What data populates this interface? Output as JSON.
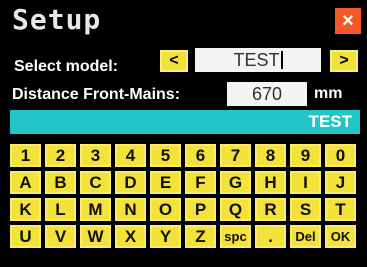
{
  "header": {
    "title": "Setup",
    "close_label": "×"
  },
  "model": {
    "label": "Select model:",
    "prev_label": "<",
    "next_label": ">",
    "value": "TEST"
  },
  "distance": {
    "label": "Distance Front-Mains:",
    "value": "670",
    "unit": "mm"
  },
  "entry": {
    "value": "TEST"
  },
  "keyboard": {
    "rows": [
      [
        "1",
        "2",
        "3",
        "4",
        "5",
        "6",
        "7",
        "8",
        "9",
        "0"
      ],
      [
        "A",
        "B",
        "C",
        "D",
        "E",
        "F",
        "G",
        "H",
        "I",
        "J"
      ],
      [
        "K",
        "L",
        "M",
        "N",
        "O",
        "P",
        "Q",
        "R",
        "S",
        "T"
      ],
      [
        "U",
        "V",
        "W",
        "X",
        "Y",
        "Z",
        "spc",
        ".",
        "Del",
        "OK"
      ]
    ]
  },
  "colors": {
    "background": "#000000",
    "key_yellow": "#f2e23a",
    "close_red": "#f25a2a",
    "entry_cyan": "#23c6c6"
  }
}
